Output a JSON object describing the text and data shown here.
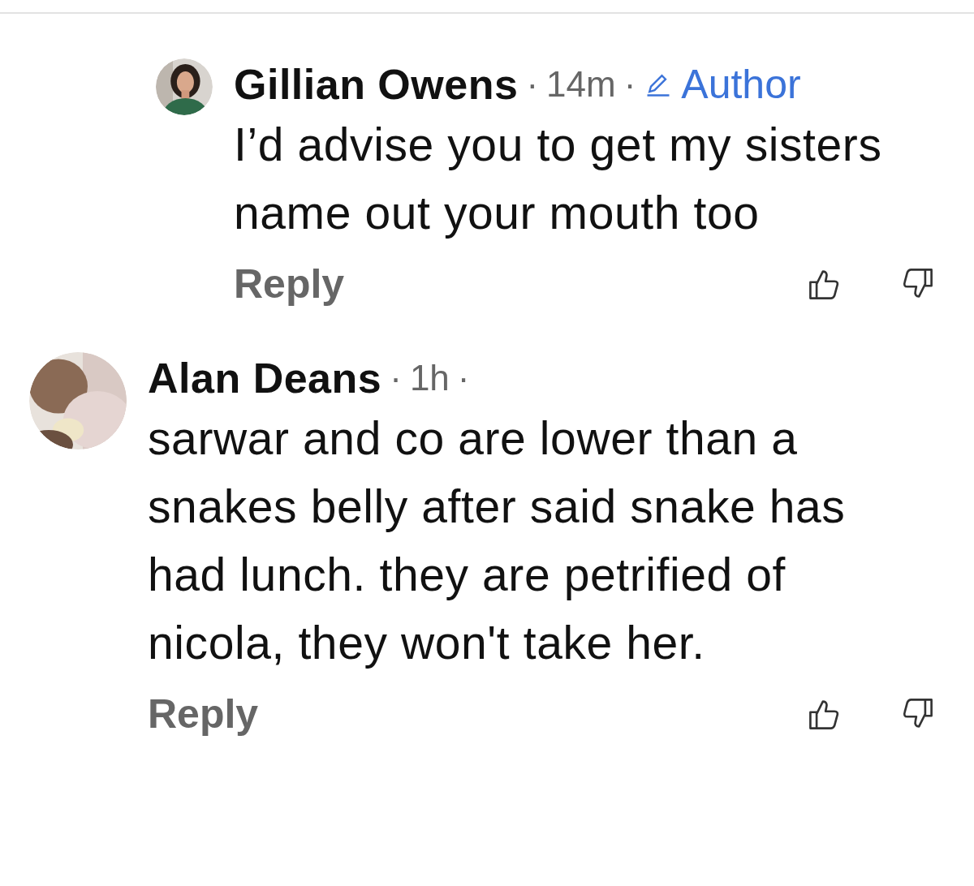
{
  "comments": [
    {
      "kind": "reply",
      "author": "Gillian Owens",
      "separator": "·",
      "time": "14m",
      "badge": "Author",
      "text": "I’d advise you to get my sisters name out your mouth too",
      "reply_label": "Reply"
    },
    {
      "kind": "top",
      "author": "Alan Deans",
      "separator": "·",
      "time": "1h",
      "text": "sarwar and co are lower than a snakes belly after said snake has had lunch. they are petrified of nicola, they won't take her.",
      "reply_label": "Reply"
    }
  ]
}
